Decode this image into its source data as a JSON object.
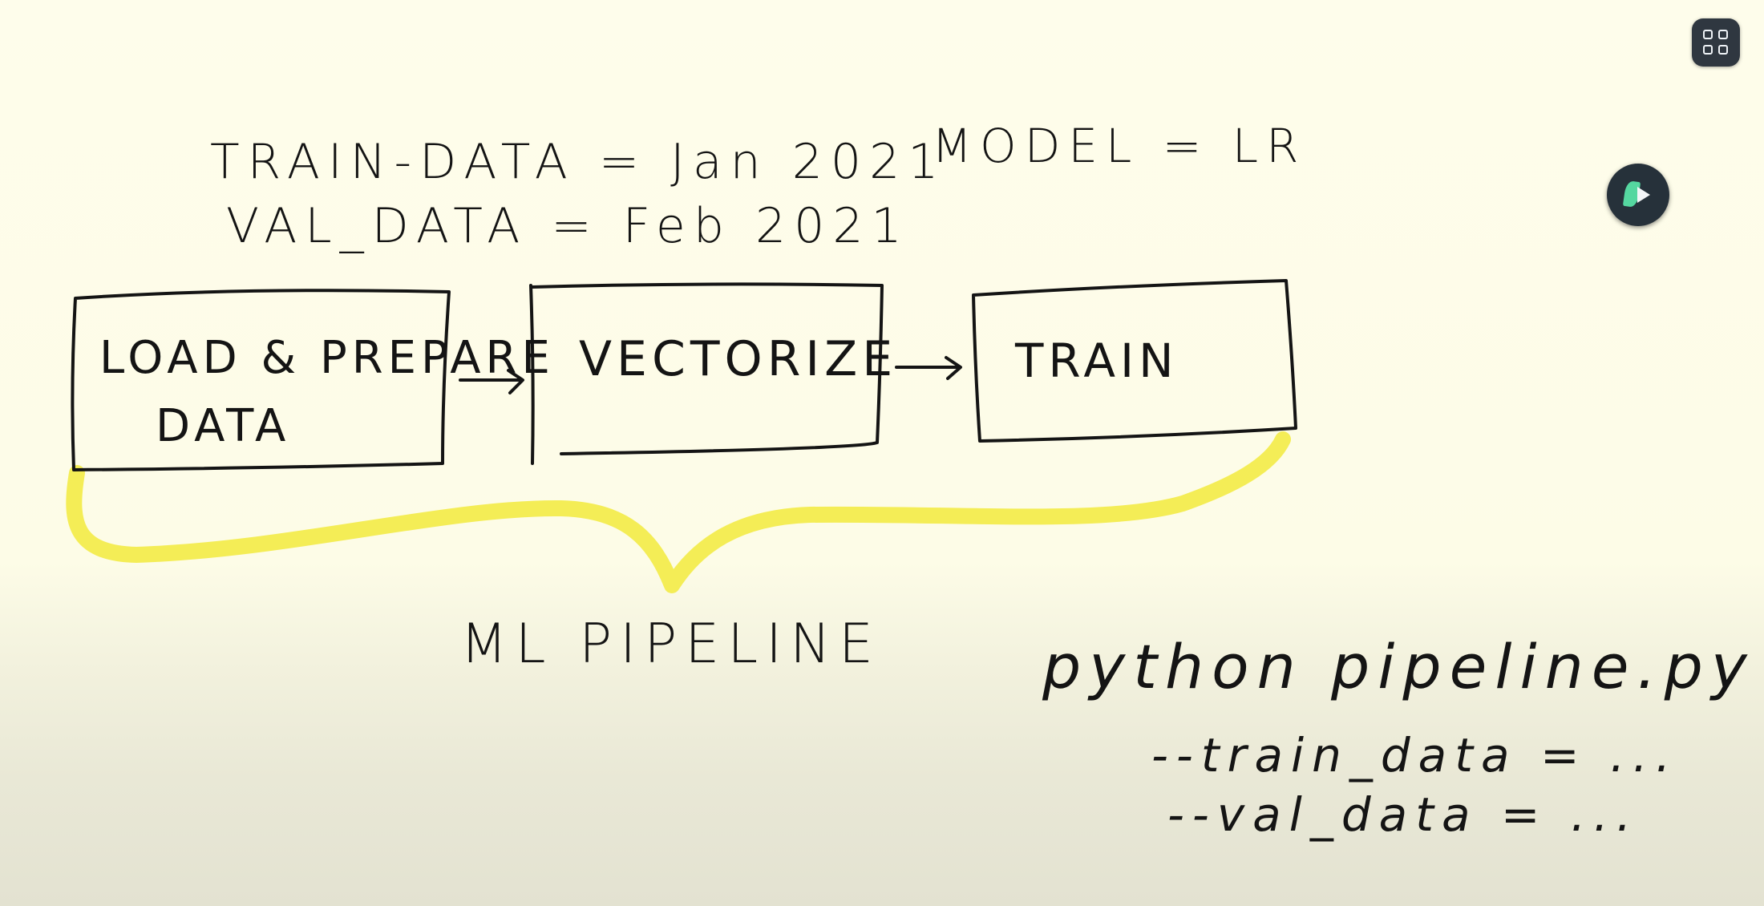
{
  "header": {
    "train_data_line": "TRAIN-DATA = Jan 2021",
    "val_data_line": "VAL_DATA = Feb 2021",
    "model_line": "MODEL = LR"
  },
  "pipeline": {
    "steps": [
      {
        "line1": "LOAD & PREPARE",
        "line2": "DATA"
      },
      {
        "line1": "VECTORIZE",
        "line2": ""
      },
      {
        "line1": "TRAIN",
        "line2": ""
      }
    ],
    "label": "ML PIPELINE",
    "highlight_color": "#f3ec4a",
    "ink_color": "#141414"
  },
  "command": {
    "line": "python pipeline.py",
    "arg1": "--train_data = ...",
    "arg2": "--val_data = ..."
  },
  "controls": {
    "grid_icon": "grid-icon",
    "play_icon": "play-icon"
  }
}
